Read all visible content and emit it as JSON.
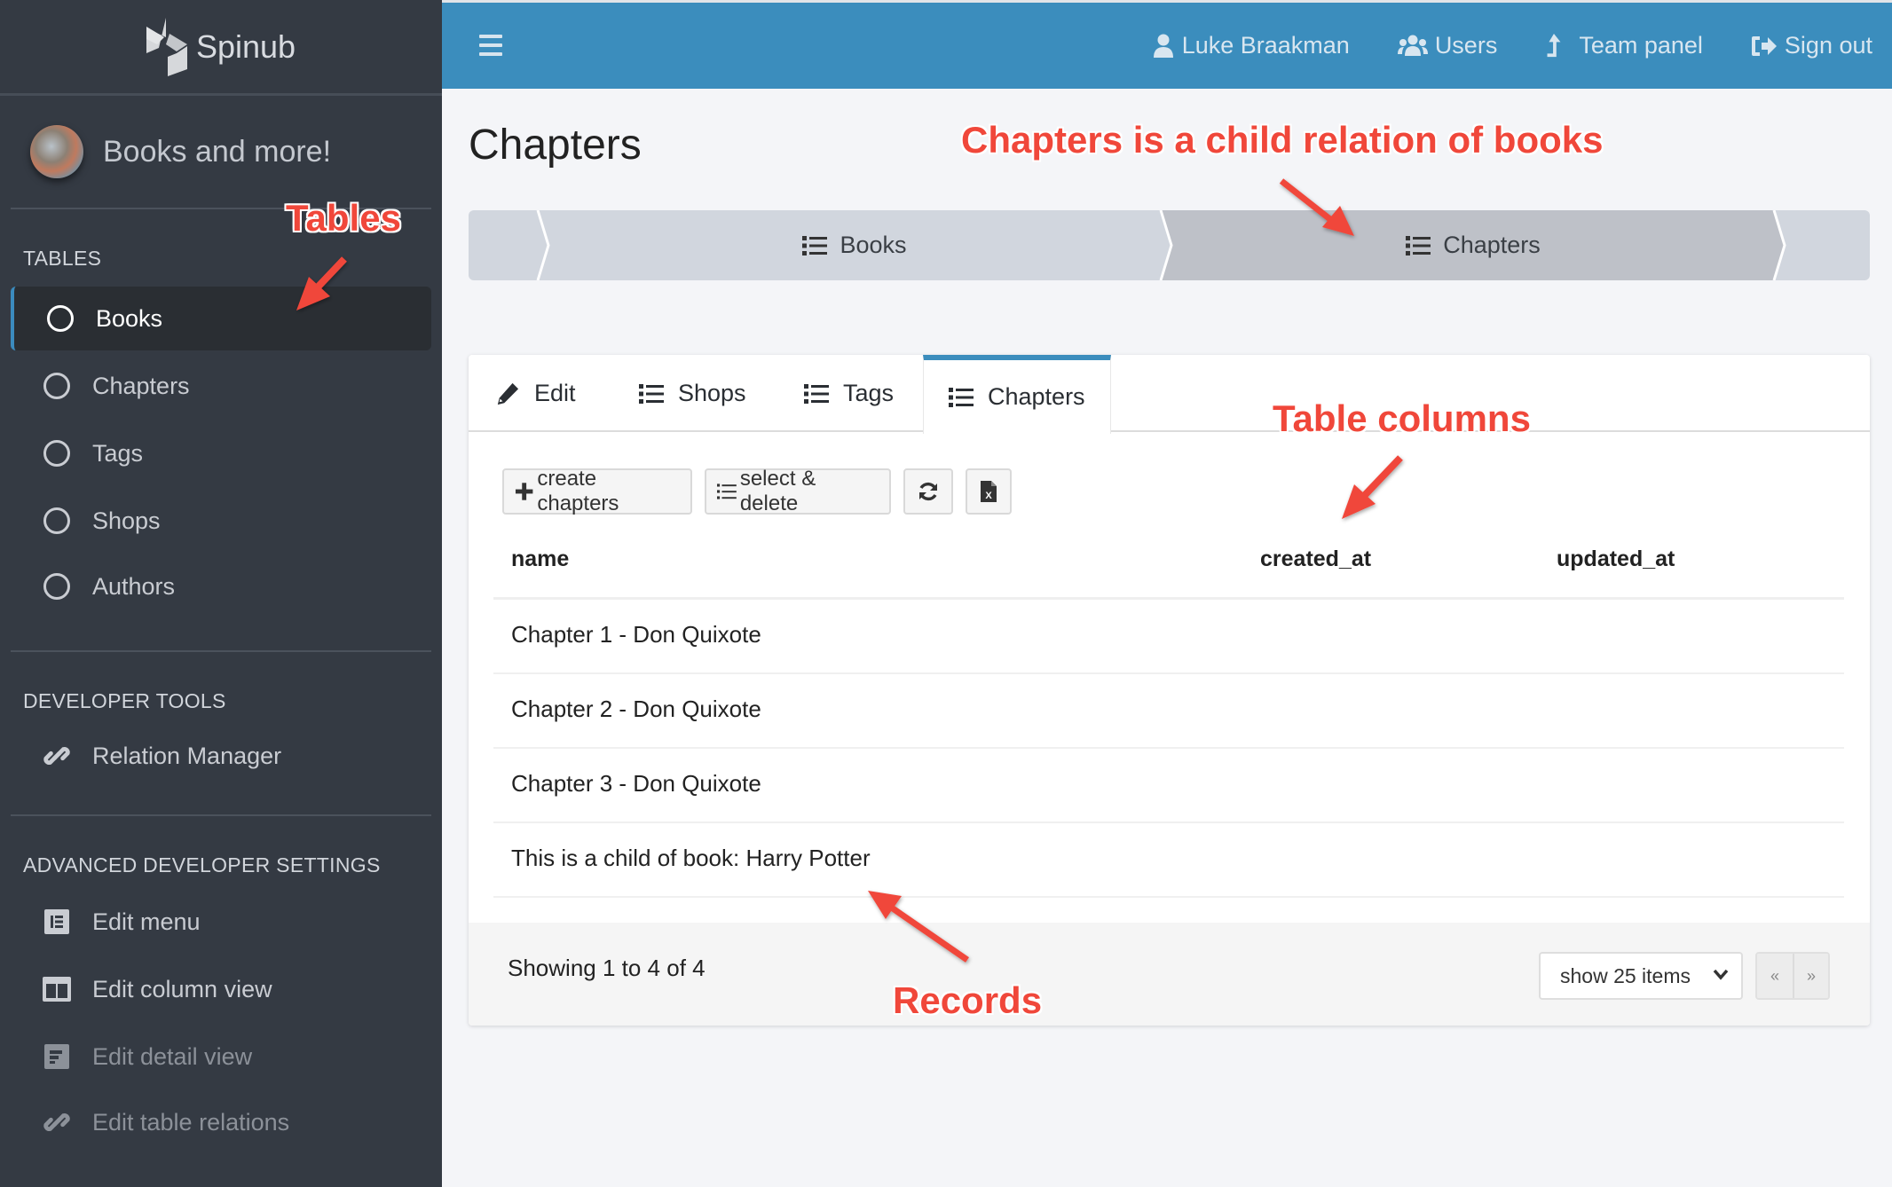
{
  "app": {
    "brand": "Spinub",
    "org_name": "Books and more!"
  },
  "sidebar": {
    "sections": [
      {
        "title": "TABLES",
        "items": [
          {
            "label": "Books",
            "icon": "circle-icon",
            "active": true
          },
          {
            "label": "Chapters",
            "icon": "circle-icon"
          },
          {
            "label": "Tags",
            "icon": "circle-icon"
          },
          {
            "label": "Shops",
            "icon": "circle-icon"
          },
          {
            "label": "Authors",
            "icon": "circle-icon"
          }
        ]
      },
      {
        "title": "DEVELOPER TOOLS",
        "items": [
          {
            "label": "Relation Manager",
            "icon": "link-icon"
          }
        ]
      },
      {
        "title": "ADVANCED DEVELOPER SETTINGS",
        "items": [
          {
            "label": "Edit menu",
            "icon": "menu-layout-icon"
          },
          {
            "label": "Edit column view",
            "icon": "columns-icon"
          },
          {
            "label": "Edit detail view",
            "icon": "detail-layout-icon",
            "muted": true
          },
          {
            "label": "Edit table relations",
            "icon": "link-icon",
            "muted": true
          }
        ]
      }
    ]
  },
  "topbar": {
    "menu_icon": "hamburger-icon",
    "links": [
      {
        "label": "Luke Braakman",
        "icon": "user-icon"
      },
      {
        "label": "Users",
        "icon": "users-icon"
      },
      {
        "label": "Team panel",
        "icon": "level-up-icon"
      },
      {
        "label": "Sign out",
        "icon": "sign-out-icon"
      }
    ],
    "color": "#3b8dbd"
  },
  "page": {
    "title": "Chapters",
    "breadcrumb": [
      {
        "label": "Books",
        "icon": "list-icon"
      },
      {
        "label": "Chapters",
        "icon": "list-icon",
        "active": true
      }
    ],
    "tabs": [
      {
        "label": "Edit",
        "icon": "pencil-icon"
      },
      {
        "label": "Shops",
        "icon": "list-icon"
      },
      {
        "label": "Tags",
        "icon": "list-icon"
      },
      {
        "label": "Chapters",
        "icon": "list-icon",
        "active": true
      }
    ],
    "toolbar": {
      "create_label": "create chapters",
      "select_delete_label": "select & delete",
      "refresh_icon": "refresh-icon",
      "export_icon": "excel-file-icon"
    },
    "table": {
      "columns": [
        "name",
        "created_at",
        "updated_at"
      ],
      "rows": [
        {
          "name": "Chapter 1 - Don Quixote",
          "created_at": "",
          "updated_at": ""
        },
        {
          "name": "Chapter 2 - Don Quixote",
          "created_at": "",
          "updated_at": ""
        },
        {
          "name": "Chapter 3 - Don Quixote",
          "created_at": "",
          "updated_at": ""
        },
        {
          "name": "This is a child of book: Harry Potter",
          "created_at": "",
          "updated_at": ""
        }
      ]
    },
    "footer": {
      "showing": "Showing 1 to 4 of 4",
      "page_size": "show 25 items",
      "prev": "«",
      "next": "»"
    }
  },
  "annotations": {
    "tables": "Tables",
    "child_relation": "Chapters is a child relation of books",
    "table_columns": "Table columns",
    "records": "Records",
    "color": "#f0473a"
  }
}
